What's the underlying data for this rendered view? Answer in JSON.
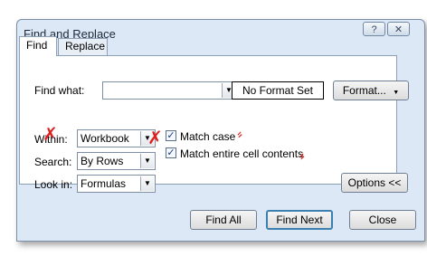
{
  "window": {
    "title": "Find and Replace",
    "help_label": "?",
    "close_label": "✕"
  },
  "tabs": [
    {
      "label": "Find",
      "active": true
    },
    {
      "label": "Replace",
      "active": false
    }
  ],
  "find": {
    "label": "Find what:",
    "value": "",
    "format_status": "No Format Set",
    "format_button": "Format...",
    "within": {
      "label": "Within:",
      "value": "Workbook"
    },
    "search": {
      "label": "Search:",
      "value": "By Rows"
    },
    "look_in": {
      "label": "Look in:",
      "value": "Formulas"
    },
    "match_case": {
      "label": "Match case",
      "checked": true
    },
    "match_entire": {
      "label": "Match entire cell contents",
      "checked": true
    },
    "options_button": "Options <<"
  },
  "buttons": {
    "find_all": "Find All",
    "find_next": "Find Next",
    "close": "Close"
  },
  "colors": {
    "dialog_bg": "#dce8f5",
    "annotation": "#e0201e",
    "default_border": "#3c7fb1"
  }
}
